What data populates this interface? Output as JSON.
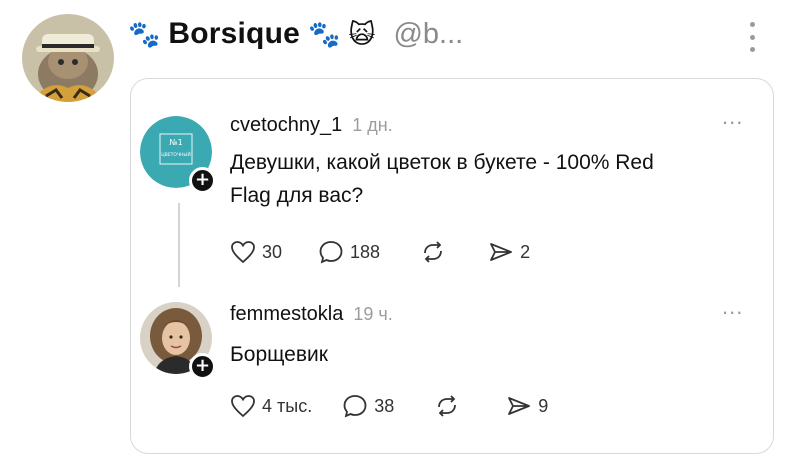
{
  "outer_post": {
    "display_name": "Borsique",
    "name_emoji_left": "🐾",
    "name_emoji_right": "🐾",
    "name_emoji_cat": "🙀",
    "handle": "@b..."
  },
  "quoted_card": {
    "posts": [
      {
        "username": "cvetochny_1",
        "time": "1 дн.",
        "avatar_text": "№1",
        "avatar_subtext": "ЦВЕТОЧНЫЙ",
        "text_line1": "Девушки, какой цветок в букете -  100% Red",
        "text_line2": "Flag для вас?",
        "likes": "30",
        "replies": "188",
        "shares": "2",
        "more": "..."
      },
      {
        "username": "femmestokla",
        "time": "19 ч.",
        "text_line1": "Борщевик",
        "likes": "4 тыс.",
        "replies": "38",
        "shares": "9",
        "more": "..."
      }
    ]
  },
  "colors": {
    "teal_avatar": "#3aa9b2",
    "border": "#d9d9d9",
    "muted": "#9c9c9c"
  },
  "icons": [
    "plus-icon",
    "heart-icon",
    "reply-icon",
    "repost-icon",
    "send-icon",
    "kebab-icon"
  ]
}
